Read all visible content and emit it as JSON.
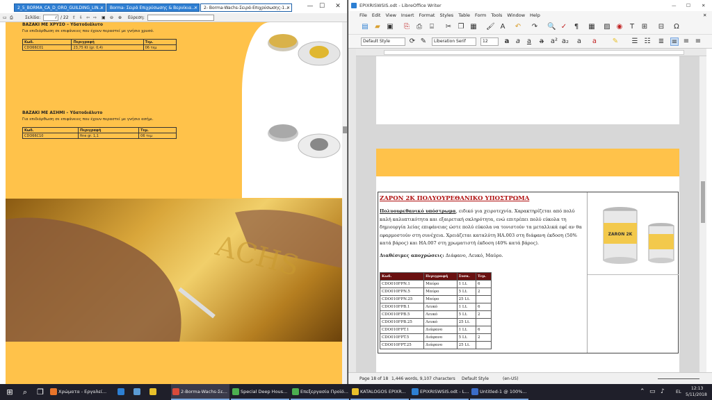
{
  "pdf": {
    "tabs": [
      {
        "label": "2_5_BORMA_CA_D_ORO_GUILDING_LIN..."
      },
      {
        "label": "Borma- Σειρά Επιχρύσωσης & Βερνίκια..."
      },
      {
        "label": "2- Borma-Wachs-Σειρά-Επιχρύσωσης-1..."
      }
    ],
    "toolbar": {
      "page_label": "Σελίδα:",
      "page_value": "7",
      "page_total": "/ 22",
      "search_label": "Εύρεση:"
    },
    "section1": {
      "title": "ΒΑΖΑΚΙ ΜΕ ΧΡΥΣΟ – Υδατοδιάλυτο",
      "desc": "Για επιδιόρθωση σε επιφάνειες που έχουν περαστεί με γνήσιο χρυσό.",
      "headers": [
        "Κωδ.",
        "Περιγραφή",
        "Τεμ."
      ],
      "row": [
        "CDO66C01",
        "23,75 Kt (gr. 0,4)",
        "06 τεμ"
      ]
    },
    "section2": {
      "title": "ΒΑΖΑΚΙ ΜΕ ΑΣΗΜΙ – Υδατοδιάλυτο",
      "desc": "Για επιδιόρθωση σε επιφάνειες που έχουν περαστεί με γνήσιο ασήμι.",
      "headers": [
        "Κωδ.",
        "Περιγραφή",
        "Τεμ."
      ],
      "row": [
        "CDO66C10",
        "fine gr. 1,1",
        "06 τεμ"
      ]
    }
  },
  "writer": {
    "title": "EPIXRISWSIS.odt - LibreOffice Writer",
    "menu": [
      "File",
      "Edit",
      "View",
      "Insert",
      "Format",
      "Styles",
      "Table",
      "Form",
      "Tools",
      "Window",
      "Help"
    ],
    "para_style": "Default Style",
    "font_name": "Liberation Serif",
    "font_size": "12",
    "doc": {
      "heading": "ΖΑΡΟΝ 2Κ ΠΟΛΥΟΥΡΕΘΑΝΙΚΟ ΥΠΟΣΤΡΩΜΑ",
      "body_bold": "Πολυουρεθανικό υπόστρωμα",
      "body": ", ειδικό για χειροτεχνία. Χαρακτηρίζεται από πολύ καλή καλυπτικότητα και εξαιρετική σκληρότητα, ενώ επιτρέπει πολύ εύκολα τη δημιουργία λείας επιφάνειας ώστε πολύ εύκολα να τονιστούν τα μεταλλικά εφέ αν θα εφαρμοστούν στη συνέχεια. Χρειάζεται καταλύτη ΗΑ.003 στη διάφανη έκδοση (50% κατά βάρος) και ΗΑ.007 στη χρωματιστή έκδοση (40% κατά βάρος).",
      "colors_bold": "Διαθέσιμες αποχρώσεις:",
      "colors": " Διάφανο, Λευκό, Μαύρο.",
      "can_label": "ZARON 2K",
      "table_headers": [
        "Κωδ.",
        "Περιγραφή",
        "Συσκ.",
        "Τεμ."
      ],
      "table_rows": [
        [
          "CDO010FPN.1",
          "Μαύρο",
          "1 Lt.",
          "6"
        ],
        [
          "CDO010FPN.5",
          "Μαύρο",
          "5 Lt.",
          "2"
        ],
        [
          "CDO010FPN.25",
          "Μαύρο",
          "25 Lt.",
          ""
        ],
        [
          "CDO010FPB.1",
          "Λευκό",
          "1 Lt.",
          "6"
        ],
        [
          "CDO010FPB.5",
          "Λευκό",
          "5 Lt.",
          "2"
        ],
        [
          "CDO010FPB.25",
          "Λευκό",
          "25 Lt.",
          ""
        ],
        [
          "CDO010FPT.1",
          "Διάφανο",
          "1 Lt.",
          "6"
        ],
        [
          "CDO010FPT.5",
          "Διάφανο",
          "5 Lt.",
          "2"
        ],
        [
          "CDO010FPT.25",
          "Διάφανο",
          "25 Lt.",
          ""
        ]
      ]
    },
    "status": {
      "page": "Page 18 of 18",
      "words": "1,446 words, 9,107 characters",
      "style": "Default Style",
      "lang": "(en-US)"
    }
  },
  "taskbar": {
    "items": [
      {
        "label": "Χρώματα - Εργαλεί...",
        "color": "#e8742a"
      },
      {
        "label": "",
        "color": "#2d7fd3"
      },
      {
        "label": "",
        "color": "#5b9bd5"
      },
      {
        "label": "",
        "color": "#e8c02a"
      },
      {
        "label": "2-Borma-Wachs-Σε...",
        "color": "#d94a3a"
      },
      {
        "label": "Special Deep Hous...",
        "color": "#4caf50"
      },
      {
        "label": "Επεξεργασία Προϊό...",
        "color": "#4caf50"
      },
      {
        "label": "KATALOGOS EPIXR...",
        "color": "#e8c02a"
      },
      {
        "label": "EPIXRISWSIS.odt - L...",
        "color": "#2d7fd3"
      },
      {
        "label": "Untitled-1 @ 100%...",
        "color": "#3a6cc8"
      }
    ],
    "lang": "EL",
    "time": "12:13",
    "date": "5/11/2018"
  }
}
